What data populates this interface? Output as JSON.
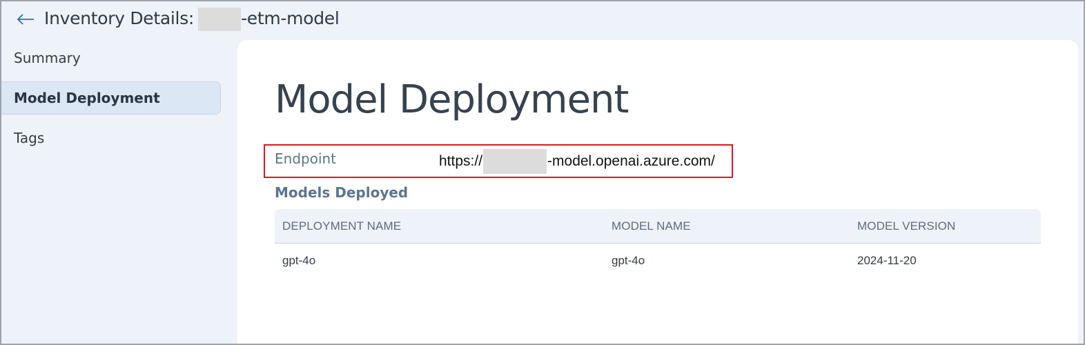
{
  "header": {
    "back_icon": "arrow-left-icon",
    "title_prefix": "Inventory Details:",
    "title_suffix": "-etm-model"
  },
  "sidebar": {
    "items": [
      {
        "label": "Summary",
        "active": false
      },
      {
        "label": "Model Deployment",
        "active": true
      },
      {
        "label": "Tags",
        "active": false
      }
    ]
  },
  "main": {
    "page_title": "Model Deployment",
    "endpoint": {
      "label": "Endpoint",
      "value_prefix": "https://",
      "value_suffix": "-model.openai.azure.com/"
    },
    "models_heading": "Models Deployed",
    "table": {
      "columns": [
        "DEPLOYMENT NAME",
        "MODEL NAME",
        "MODEL VERSION"
      ],
      "rows": [
        [
          "gpt-4o",
          "gpt-4o",
          "2024-11-20"
        ]
      ]
    }
  },
  "colors": {
    "highlight_border": "#e0161f",
    "active_nav_bg": "#dbe7f5",
    "accent_blue": "#1a73c7"
  }
}
